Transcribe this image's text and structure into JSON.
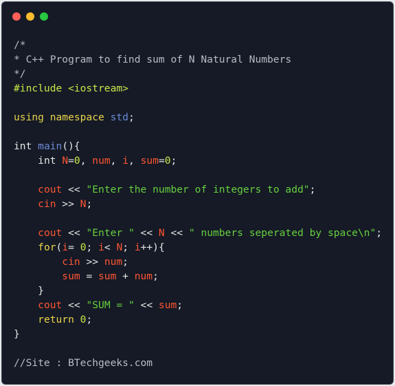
{
  "window": {
    "controls": [
      {
        "name": "close-dot",
        "color": "#ff5f57"
      },
      {
        "name": "minimize-dot",
        "color": "#febc2e"
      },
      {
        "name": "zoom-dot",
        "color": "#28c840"
      }
    ]
  },
  "code": {
    "lines": [
      [
        {
          "t": "/*",
          "c": "comment"
        }
      ],
      [
        {
          "t": "* C++ Program to find sum of N Natural Numbers",
          "c": "comment"
        }
      ],
      [
        {
          "t": "*/",
          "c": "comment"
        }
      ],
      [
        {
          "t": "#include <iostream>",
          "c": "preproc"
        }
      ],
      [],
      [
        {
          "t": "using",
          "c": "kw"
        },
        {
          "t": " ",
          "c": "plain"
        },
        {
          "t": "namespace",
          "c": "kw"
        },
        {
          "t": " ",
          "c": "plain"
        },
        {
          "t": "std",
          "c": "ns"
        },
        {
          "t": ";",
          "c": "punc"
        }
      ],
      [],
      [
        {
          "t": "int",
          "c": "type"
        },
        {
          "t": " ",
          "c": "plain"
        },
        {
          "t": "main",
          "c": "fn"
        },
        {
          "t": "(){",
          "c": "punc"
        }
      ],
      [
        {
          "t": "    ",
          "c": "plain"
        },
        {
          "t": "int",
          "c": "type"
        },
        {
          "t": " ",
          "c": "plain"
        },
        {
          "t": "N",
          "c": "var"
        },
        {
          "t": "=",
          "c": "op"
        },
        {
          "t": "0",
          "c": "num"
        },
        {
          "t": ", ",
          "c": "punc"
        },
        {
          "t": "num",
          "c": "var"
        },
        {
          "t": ", ",
          "c": "punc"
        },
        {
          "t": "i",
          "c": "var"
        },
        {
          "t": ", ",
          "c": "punc"
        },
        {
          "t": "sum",
          "c": "var"
        },
        {
          "t": "=",
          "c": "op"
        },
        {
          "t": "0",
          "c": "num"
        },
        {
          "t": ";",
          "c": "punc"
        }
      ],
      [],
      [
        {
          "t": "    ",
          "c": "plain"
        },
        {
          "t": "cout",
          "c": "var"
        },
        {
          "t": " << ",
          "c": "op"
        },
        {
          "t": "\"Enter the number of integers to add\"",
          "c": "str"
        },
        {
          "t": ";",
          "c": "punc"
        }
      ],
      [
        {
          "t": "    ",
          "c": "plain"
        },
        {
          "t": "cin",
          "c": "var"
        },
        {
          "t": " >> ",
          "c": "op"
        },
        {
          "t": "N",
          "c": "var"
        },
        {
          "t": ";",
          "c": "punc"
        }
      ],
      [],
      [
        {
          "t": "    ",
          "c": "plain"
        },
        {
          "t": "cout",
          "c": "var"
        },
        {
          "t": " << ",
          "c": "op"
        },
        {
          "t": "\"Enter \"",
          "c": "str"
        },
        {
          "t": " << ",
          "c": "op"
        },
        {
          "t": "N",
          "c": "var"
        },
        {
          "t": " << ",
          "c": "op"
        },
        {
          "t": "\" numbers seperated by space\\n\"",
          "c": "str"
        },
        {
          "t": ";",
          "c": "punc"
        }
      ],
      [
        {
          "t": "    ",
          "c": "plain"
        },
        {
          "t": "for",
          "c": "kw"
        },
        {
          "t": "(",
          "c": "punc"
        },
        {
          "t": "i",
          "c": "var"
        },
        {
          "t": "= ",
          "c": "op"
        },
        {
          "t": "0",
          "c": "num"
        },
        {
          "t": "; ",
          "c": "punc"
        },
        {
          "t": "i",
          "c": "var"
        },
        {
          "t": "< ",
          "c": "op"
        },
        {
          "t": "N",
          "c": "var"
        },
        {
          "t": "; ",
          "c": "punc"
        },
        {
          "t": "i",
          "c": "var"
        },
        {
          "t": "++){",
          "c": "op"
        }
      ],
      [
        {
          "t": "        ",
          "c": "plain"
        },
        {
          "t": "cin",
          "c": "var"
        },
        {
          "t": " >> ",
          "c": "op"
        },
        {
          "t": "num",
          "c": "var"
        },
        {
          "t": ";",
          "c": "punc"
        }
      ],
      [
        {
          "t": "        ",
          "c": "plain"
        },
        {
          "t": "sum",
          "c": "var"
        },
        {
          "t": " = ",
          "c": "op"
        },
        {
          "t": "sum",
          "c": "var"
        },
        {
          "t": " + ",
          "c": "op"
        },
        {
          "t": "num",
          "c": "var"
        },
        {
          "t": ";",
          "c": "punc"
        }
      ],
      [
        {
          "t": "    }",
          "c": "punc"
        }
      ],
      [
        {
          "t": "    ",
          "c": "plain"
        },
        {
          "t": "cout",
          "c": "var"
        },
        {
          "t": " << ",
          "c": "op"
        },
        {
          "t": "\"SUM = \"",
          "c": "str"
        },
        {
          "t": " << ",
          "c": "op"
        },
        {
          "t": "sum",
          "c": "var"
        },
        {
          "t": ";",
          "c": "punc"
        }
      ],
      [
        {
          "t": "    ",
          "c": "plain"
        },
        {
          "t": "return",
          "c": "kw"
        },
        {
          "t": " ",
          "c": "plain"
        },
        {
          "t": "0",
          "c": "num"
        },
        {
          "t": ";",
          "c": "punc"
        }
      ],
      [
        {
          "t": "}",
          "c": "punc"
        }
      ],
      [],
      [
        {
          "t": "//Site : BTechgeeks.com",
          "c": "comment"
        }
      ]
    ]
  }
}
